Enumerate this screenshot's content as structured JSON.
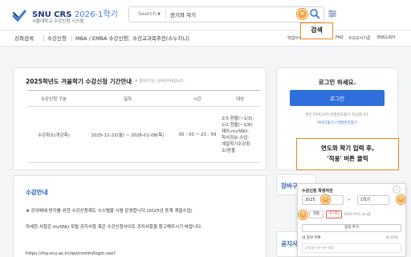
{
  "header": {
    "logo_main": "SNU CRS",
    "logo_term": "2026-1학기",
    "logo_sub": "서울대학교 수강신청 시스템",
    "search_scope": "Search",
    "search_value": "전기와 자기",
    "step4_badge": "④"
  },
  "nav": {
    "items": [
      "강좌검색",
      "수강신청",
      "MBA / EMBA 수강신청",
      "수강교과목추천(스누지니)"
    ],
    "utils": [
      "학업이수",
      "FAQ",
      "수강교사기준",
      "ENGLISH"
    ]
  },
  "callouts": {
    "search": "검색",
    "instruction_line1": "연도와 학기 입력 후,",
    "instruction_line2": "'적용' 버튼 클릭"
  },
  "period": {
    "title": "2025학년도 겨울학기 수강신청 기간안내",
    "note": "※ 접속기기는 상위순이내입니다.",
    "headers": [
      "수강신청 구분",
      "일자",
      "시간",
      "대상"
    ],
    "row": {
      "type": "수강취소(개강후)",
      "date": "2025-12-22(월) ~ 2026-01-08(목)",
      "time": "00 : 00 ~ 23 : 59",
      "target": [
        "2/3 환불(~1/3),",
        "1/2 환불(~1/8)",
        "제외:mySNU-",
        "학사정보-수업-",
        "계절학기수강취",
        "소/환불"
      ]
    }
  },
  "notice": {
    "title": "수강안내",
    "line1": "★ 강의배에 방지를 위한 수강신청제도 시스템을 시범 운영합니다.(2025년 동계 계절수업)",
    "line2": "자세한 사항은 mySNU 포털 공지사항 혹은 수강신청사이트 공지사항을 참고해주시기 바랍니다.",
    "link": "https://my.snu.ac.kr/spi/comm/login.sso?"
  },
  "login": {
    "title": "로그인 하세요.",
    "button": "로그인",
    "hint": "본인 아이디(학) 비밀번호찾기 가능합니다.",
    "links": "아이디찾기 / 비밀번호찾기"
  },
  "sidebar_partial": {
    "cart": "장바구",
    "notice": "공지사"
  },
  "popup": {
    "title": "수강신청 학생저선",
    "close": "–",
    "year": "2025",
    "term": "1학기",
    "chev": "▾",
    "step1": "①",
    "step2": "②",
    "step3": "③",
    "apply": "적용",
    "reset": "초기화",
    "status": "2026-1학기 표시중",
    "add_subject": "장의 추가",
    "mylist_label": "내 강의 목록",
    "mylist_count": "총 0학점",
    "mylist_empty": "강의명 이수구분 학점"
  }
}
